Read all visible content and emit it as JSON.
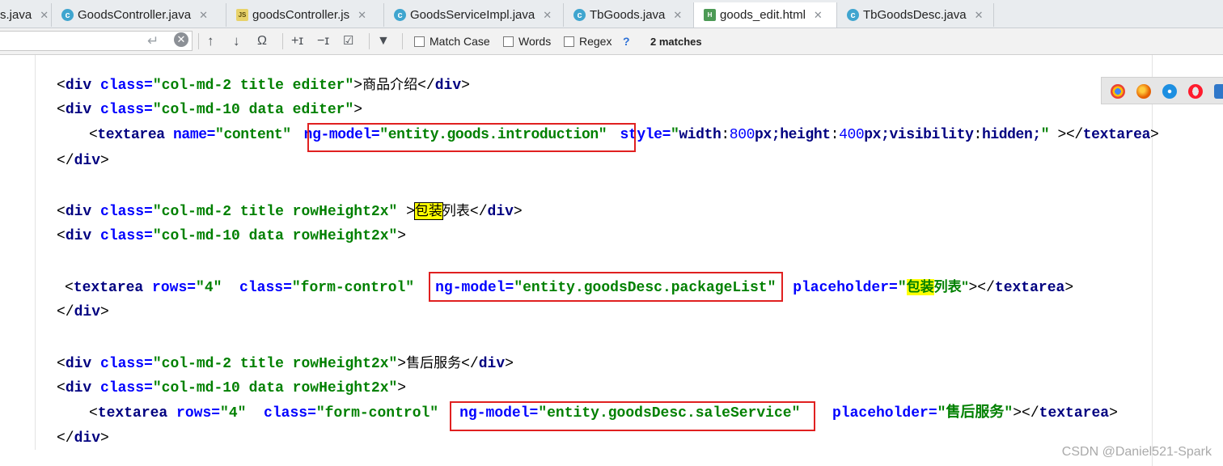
{
  "tabs": [
    {
      "label": "s.java",
      "icon": "java-class-icon"
    },
    {
      "label": "GoodsController.java",
      "icon": "java-class-icon"
    },
    {
      "label": "goodsController.js",
      "icon": "js-file-icon"
    },
    {
      "label": "GoodsServiceImpl.java",
      "icon": "java-class-icon"
    },
    {
      "label": "TbGoods.java",
      "icon": "java-class-icon"
    },
    {
      "label": "goods_edit.html",
      "icon": "html-file-icon"
    },
    {
      "label": "TbGoodsDesc.java",
      "icon": "java-class-icon"
    }
  ],
  "find": {
    "match_case": "Match Case",
    "words": "Words",
    "regex": "Regex",
    "help": "?",
    "matches": "2 matches"
  },
  "code": {
    "l1": {
      "o1": "<",
      "t1": "div",
      "a1": " class=",
      "v1": "\"col-md-2 title editer\"",
      "c1": ">",
      "text": "商品介绍",
      "o2": "</",
      "t2": "div",
      "c2": ">"
    },
    "l2": {
      "o1": "<",
      "t1": "div",
      "a1": " class=",
      "v1": "\"col-md-10 data editer\"",
      "c1": ">"
    },
    "l3": {
      "o1": "<",
      "t1": "textarea",
      "a1": " name=",
      "v1": "\"content\"",
      "a2": "ng-model=",
      "v2": "\"entity.goods.introduction\"",
      "a3": " style=",
      "q1": "\"",
      "s1": "width",
      "s2": ":",
      "n1": "800",
      "s3": "px;",
      "s4": "height",
      "s5": ":",
      "n2": "400",
      "s6": "px;",
      "s7": "visibility",
      "s8": ":",
      "s9": "hidden;",
      "q2": "\"",
      "c1": " ></",
      "t2": "textarea",
      "c2": ">"
    },
    "l4": {
      "o1": "</",
      "t1": "div",
      "c1": ">"
    },
    "l5": {
      "o1": "<",
      "t1": "div",
      "a1": " class=",
      "v1": "\"col-md-2 title rowHeight2x\"",
      "c1": " >",
      "hl": "包装",
      "text": "列表",
      "o2": "</",
      "t2": "div",
      "c2": ">"
    },
    "l6": {
      "o1": "<",
      "t1": "div",
      "a1": " class=",
      "v1": "\"col-md-10 data rowHeight2x\"",
      "c1": ">"
    },
    "l7": {
      "o1": "<",
      "t1": "textarea",
      "a1": " rows=",
      "v1": "\"4\"",
      "a2": "  class=",
      "v2": "\"form-control\"",
      "a3": "ng-model=",
      "v3": "\"entity.goodsDesc.packageList\"",
      "a4": " placeholder=",
      "q1": "\"",
      "hl": "包装",
      "v4": "列表\"",
      "c1": "></",
      "t2": "textarea",
      "c2": ">"
    },
    "l8": {
      "o1": "</",
      "t1": "div",
      "c1": ">"
    },
    "l9": {
      "o1": "<",
      "t1": "div",
      "a1": " class=",
      "v1": "\"col-md-2 title rowHeight2x\"",
      "c1": ">",
      "text": "售后服务",
      "o2": "</",
      "t2": "div",
      "c2": ">"
    },
    "l10": {
      "o1": "<",
      "t1": "div",
      "a1": " class=",
      "v1": "\"col-md-10 data rowHeight2x\"",
      "c1": ">"
    },
    "l11": {
      "o1": "<",
      "t1": "textarea",
      "a1": " rows=",
      "v1": "\"4\"",
      "a2": "  class=",
      "v2": "\"form-control\"",
      "a3": "ng-model=",
      "v3": "\"entity.goodsDesc.saleService\"",
      "a4": "  placeholder=",
      "v4": "\"售后服务\"",
      "c1": "></",
      "t2": "textarea",
      "c2": ">"
    },
    "l12": {
      "o1": "</",
      "t1": "div",
      "c1": ">"
    }
  },
  "colors": {
    "highlight": "#ffff00",
    "redbox": "#e02020",
    "tag": "#000080",
    "attr": "#0000ff",
    "value": "#008000"
  },
  "watermark": "CSDN @Daniel521-Spark"
}
